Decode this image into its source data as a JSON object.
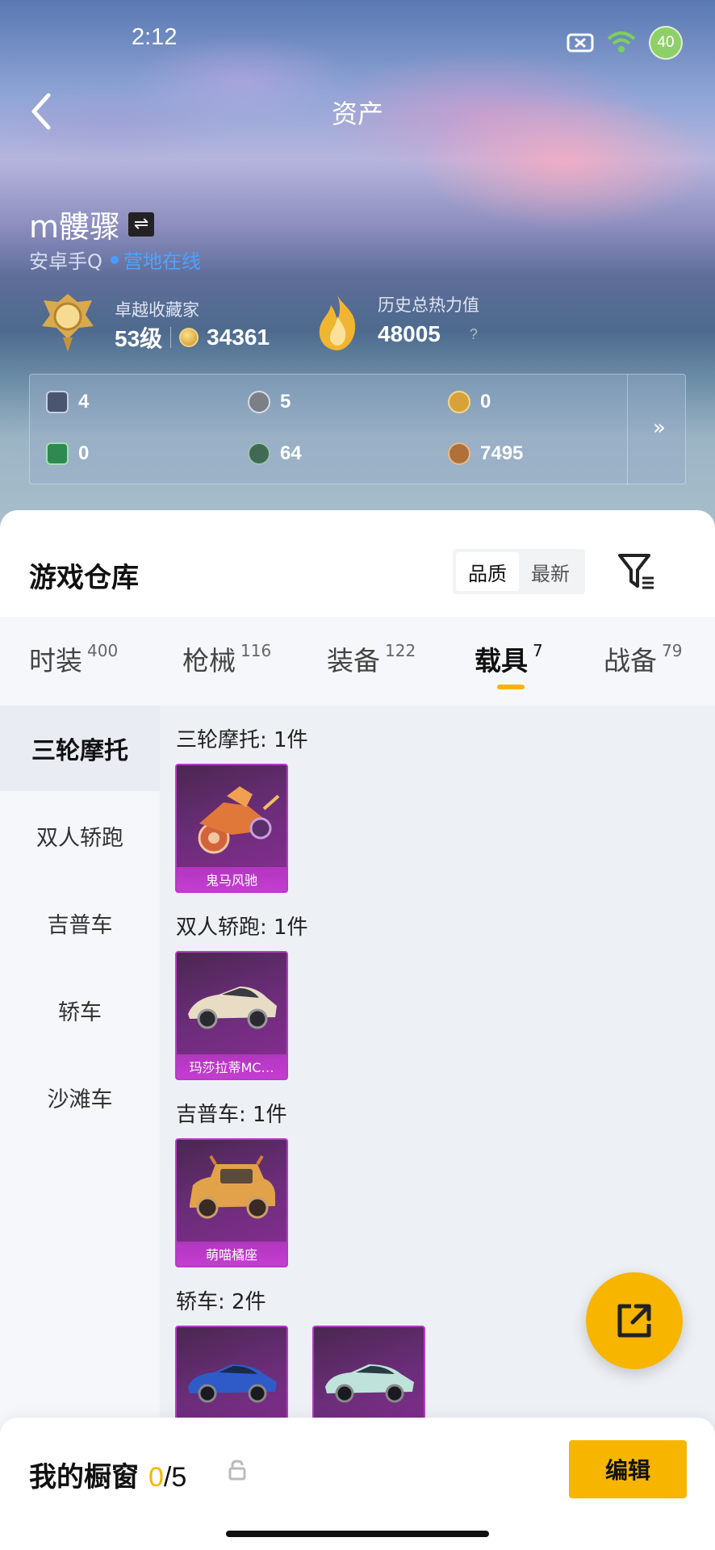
{
  "status_bar": {
    "time": "2:12",
    "battery": "40"
  },
  "header": {
    "title": "资产"
  },
  "profile": {
    "username": "m髏骤",
    "platform": "安卓手Q",
    "online_status": "营地在线",
    "collector_title": "卓越收藏家",
    "level": "53级",
    "collection_points": "34361",
    "heat_label": "历史总热力值",
    "heat_value": "48005",
    "heat_help": "?"
  },
  "assets": [
    {
      "icon": "card-icon",
      "value": "4",
      "color": "#4a5570"
    },
    {
      "icon": "silver-coin-icon",
      "value": "5",
      "color": "#7a7f88"
    },
    {
      "icon": "gold-token-icon",
      "value": "0",
      "color": "#d8a23a"
    },
    {
      "icon": "green-card-icon",
      "value": "0",
      "color": "#2f8a52"
    },
    {
      "icon": "green-orb-icon",
      "value": "64",
      "color": "#3f6a55"
    },
    {
      "icon": "bronze-coin-icon",
      "value": "7495",
      "color": "#b0703a"
    }
  ],
  "warehouse": {
    "title": "游戏仓库",
    "sort_options": [
      "品质",
      "最新"
    ],
    "active_sort": "品质"
  },
  "tabs": [
    {
      "label": "时装",
      "count": "400"
    },
    {
      "label": "枪械",
      "count": "116"
    },
    {
      "label": "装备",
      "count": "122"
    },
    {
      "label": "载具",
      "count": "7"
    },
    {
      "label": "战备",
      "count": "79"
    }
  ],
  "active_tab": "载具",
  "sidebar": [
    {
      "label": "三轮摩托"
    },
    {
      "label": "双人轿跑"
    },
    {
      "label": "吉普车"
    },
    {
      "label": "轿车"
    },
    {
      "label": "沙滩车"
    }
  ],
  "groups": [
    {
      "title": "三轮摩托: 1件",
      "items": [
        {
          "name": "鬼马风驰"
        }
      ]
    },
    {
      "title": "双人轿跑: 1件",
      "items": [
        {
          "name": "玛莎拉蒂MC…"
        }
      ]
    },
    {
      "title": "吉普车: 1件",
      "items": [
        {
          "name": "萌喵橘座"
        }
      ]
    },
    {
      "title": "轿车: 2件",
      "items": [
        {
          "name": ""
        },
        {
          "name": ""
        }
      ]
    }
  ],
  "showcase": {
    "label": "我的橱窗",
    "current": "0",
    "total": "/5",
    "edit_label": "编辑"
  },
  "colors": {
    "accent": "#f7b500",
    "card_purple": "#b43cc4",
    "online_blue": "#4aa3ff"
  }
}
